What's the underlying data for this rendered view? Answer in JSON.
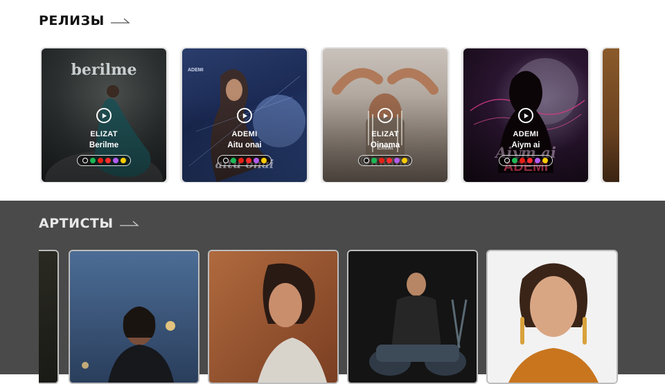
{
  "releases": {
    "title": "РЕЛИЗЫ",
    "cards": [
      {
        "artist": "ELIZAT",
        "track": "Berilme",
        "cover_text": "berilme"
      },
      {
        "artist": "ADEMI",
        "track": "Aitu onai",
        "cover_text": "aitu onai",
        "cover_small": "ADEMI"
      },
      {
        "artist": "ELIZAT",
        "track": "Oinama",
        "cover_text": "Oinama",
        "cover_small": "Elizat"
      },
      {
        "artist": "ADEMI",
        "track": "Aiym ai",
        "cover_text": "Aiym ai",
        "cover_small": "ADEMI"
      }
    ],
    "platform_icons": [
      "apple-music-icon",
      "spotify-icon",
      "youtube-icon",
      "youtube-music-icon",
      "itunes-icon",
      "yandex-music-icon"
    ]
  },
  "artists": {
    "title": "АРТИСТЫ"
  },
  "colors": {
    "artists_band": "#4a4a4a",
    "accent_white": "#ffffff"
  }
}
